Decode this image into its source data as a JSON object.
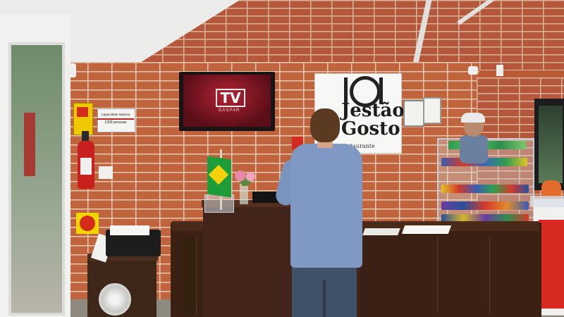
{
  "scene": {
    "description_tags": [
      "restaurant-counter",
      "brick-wall",
      "customer",
      "snack-display"
    ]
  },
  "tv": {
    "logo": "TV",
    "subtitle": "GASPAR"
  },
  "restaurant_sign": {
    "line1": "Jestão",
    "line2": "Gosto",
    "line3": "Restaurante"
  },
  "capacity_sign": {
    "line1": "Capacidade Máxima",
    "line2": "1200 pessoas"
  },
  "colors": {
    "brick": "#c0643e",
    "counter_wood": "#3b2014",
    "tv_screen": "#b12233",
    "shirt": "#7f99c4"
  }
}
